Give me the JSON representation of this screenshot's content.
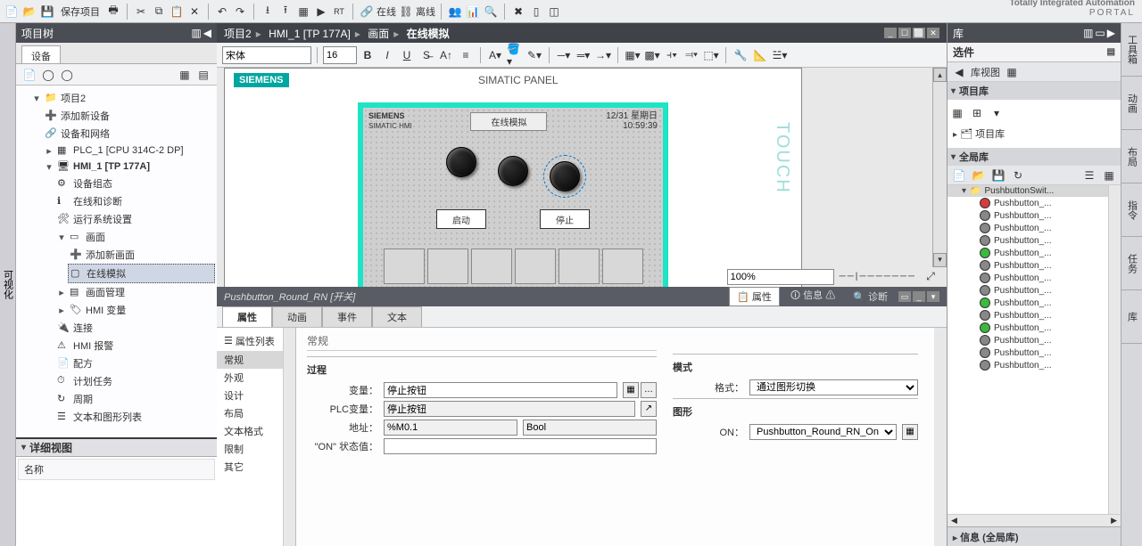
{
  "portal": {
    "line1": "Totally Integrated Automation",
    "line2": "PORTAL"
  },
  "toolbar": {
    "save_label": "保存项目",
    "online": "在线",
    "offline": "离线"
  },
  "left_sidebar_tab": "可视化",
  "project_tree": {
    "title": "项目树",
    "devices_tab": "设备"
  },
  "tree": {
    "root": "项目2",
    "add_device": "添加新设备",
    "dev_net": "设备和网络",
    "plc": "PLC_1 [CPU 314C-2 DP]",
    "hmi": "HMI_1 [TP 177A]",
    "hmi_children": {
      "dev_cfg": "设备组态",
      "online_diag": "在线和诊断",
      "run_settings": "运行系统设置",
      "screens": "画面",
      "add_screen": "添加新画面",
      "online_sim": "在线模拟",
      "screen_mgmt": "画面管理",
      "hmi_vars": "HMI 变量",
      "connections": "连接",
      "alarms": "HMI 报警",
      "recipes": "配方",
      "tasks": "计划任务",
      "cycles": "周期",
      "text_lists": "文本和图形列表"
    }
  },
  "detail_view": {
    "title": "详细视图",
    "name_col": "名称"
  },
  "breadcrumb": {
    "p1": "项目2",
    "p2": "HMI_1 [TP 177A]",
    "p3": "画面",
    "p4": "在线模拟"
  },
  "editor": {
    "font_name": "宋体",
    "font_size": "16"
  },
  "hmi": {
    "brand": "SIEMENS",
    "panel": "SIMATIC PANEL",
    "small_brand": "SIEMENS",
    "small_sub": "SIMATIC HMI",
    "screen_title": "在线模拟",
    "date": "12/31  星期日",
    "time": "10:59:39",
    "btn_start": "启动",
    "btn_stop": "停止",
    "touch": "TOUCH"
  },
  "zoom": "100%",
  "prop": {
    "header": "Pushbutton_Round_RN  [开关]",
    "tab_prop": "属性",
    "tab_info": "信息",
    "tab_diag": "诊断",
    "subtab_prop": "属性",
    "subtab_anim": "动画",
    "subtab_event": "事件",
    "subtab_text": "文本",
    "list_header": "属性列表",
    "list": [
      "常规",
      "外观",
      "设计",
      "布局",
      "文本格式",
      "限制",
      "其它"
    ],
    "big_section": "常规",
    "process_title": "过程",
    "var_label": "变量：",
    "var_value": "停止按钮",
    "plcvar_label": "PLC变量：",
    "plcvar_value": "停止按钮",
    "addr_label": "地址：",
    "addr_value": "%M0.1",
    "addr_type": "Bool",
    "onstate_label": "\"ON\" 状态值：",
    "mode_title": "模式",
    "mode_format_label": "格式：",
    "mode_format_value": "通过图形切换",
    "graph_title": "图形",
    "graph_on_label": "ON：",
    "graph_on_value": "Pushbutton_Round_RN_On"
  },
  "lib": {
    "title": "库",
    "options": "选件",
    "view_btn": "库视图",
    "proj_lib": "项目库",
    "proj_lib_root": "项目库",
    "global_lib": "全局库",
    "switch_root": "PushbuttonSwit...",
    "items": [
      {
        "c": "#d63c3c",
        "t": "Pushbutton_..."
      },
      {
        "c": "#888",
        "t": "Pushbutton_..."
      },
      {
        "c": "#888",
        "t": "Pushbutton_..."
      },
      {
        "c": "#888",
        "t": "Pushbutton_..."
      },
      {
        "c": "#3cba3c",
        "t": "Pushbutton_..."
      },
      {
        "c": "#888",
        "t": "Pushbutton_..."
      },
      {
        "c": "#888",
        "t": "Pushbutton_..."
      },
      {
        "c": "#888",
        "t": "Pushbutton_..."
      },
      {
        "c": "#3cba3c",
        "t": "Pushbutton_..."
      },
      {
        "c": "#888",
        "t": "Pushbutton_..."
      },
      {
        "c": "#3cba3c",
        "t": "Pushbutton_..."
      },
      {
        "c": "#888",
        "t": "Pushbutton_..."
      },
      {
        "c": "#888",
        "t": "Pushbutton_..."
      },
      {
        "c": "#888",
        "t": "Pushbutton_..."
      }
    ],
    "info_footer": "信息 (全局库)"
  },
  "right_tabs": [
    "工具箱",
    "动画",
    "布局",
    "指令",
    "任务",
    "库"
  ]
}
